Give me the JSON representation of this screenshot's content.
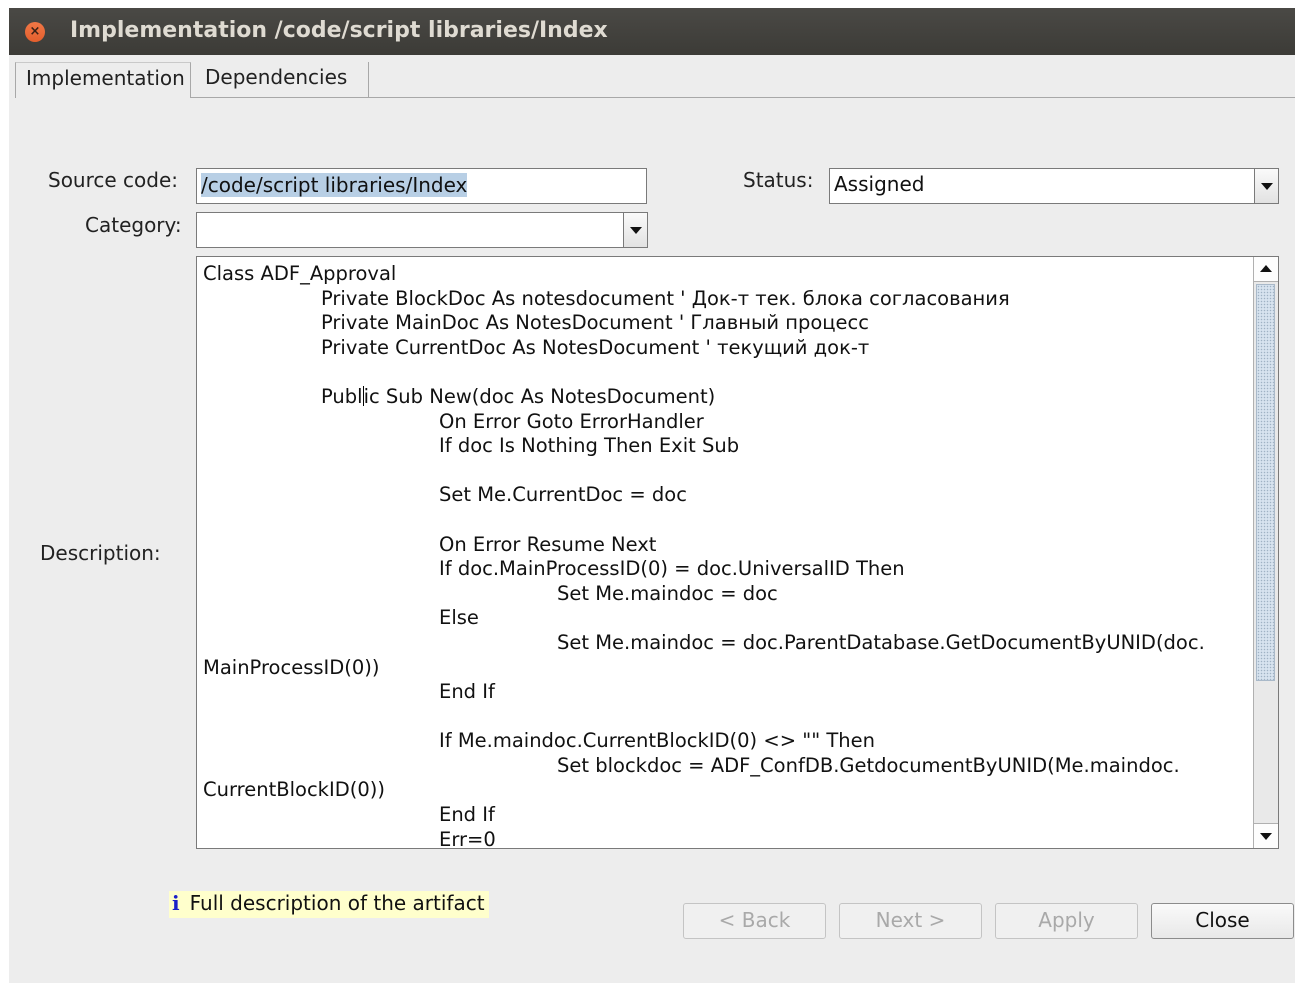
{
  "window": {
    "title": "Implementation /code/script libraries/Index"
  },
  "tabs": [
    {
      "label": "Implementation",
      "active": true
    },
    {
      "label": "Dependencies",
      "active": false
    }
  ],
  "form": {
    "source_code_label": "Source code:",
    "source_code_value": "/code/script libraries/Index",
    "status_label": "Status:",
    "status_value": "Assigned",
    "category_label": "Category:",
    "category_value": "",
    "description_label": "Description:",
    "description_lines": [
      {
        "indent": 0,
        "text": "Class ADF_Approval"
      },
      {
        "indent": 1,
        "text": "Private BlockDoc As notesdocument ' Док-т тек. блока согласования"
      },
      {
        "indent": 1,
        "text": "Private MainDoc As NotesDocument ' Главный процесс"
      },
      {
        "indent": 1,
        "text": "Private CurrentDoc As NotesDocument ' текущий док-т"
      },
      {
        "indent": 0,
        "text": ""
      },
      {
        "indent": 1,
        "text": "Public Sub New(doc As NotesDocument)"
      },
      {
        "indent": 2,
        "text": "On Error Goto ErrorHandler"
      },
      {
        "indent": 2,
        "text": "If doc Is Nothing Then Exit Sub"
      },
      {
        "indent": 0,
        "text": ""
      },
      {
        "indent": 2,
        "text": "Set Me.CurrentDoc = doc"
      },
      {
        "indent": 0,
        "text": ""
      },
      {
        "indent": 2,
        "text": "On Error Resume Next"
      },
      {
        "indent": 2,
        "text": "If doc.MainProcessID(0) = doc.UniversalID Then"
      },
      {
        "indent": 3,
        "text": "Set Me.maindoc = doc"
      },
      {
        "indent": 2,
        "text": "Else"
      },
      {
        "indent": 3,
        "text": "Set Me.maindoc = doc.ParentDatabase.GetDocumentByUNID(doc."
      },
      {
        "indent": 0,
        "text": "MainProcessID(0))"
      },
      {
        "indent": 2,
        "text": "End If"
      },
      {
        "indent": 0,
        "text": ""
      },
      {
        "indent": 2,
        "text": "If Me.maindoc.CurrentBlockID(0) <> \"\" Then"
      },
      {
        "indent": 3,
        "text": "Set blockdoc = ADF_ConfDB.GetdocumentByUNID(Me.maindoc."
      },
      {
        "indent": 0,
        "text": "CurrentBlockID(0))"
      },
      {
        "indent": 2,
        "text": "End If"
      },
      {
        "indent": 2,
        "text": "Err=0"
      }
    ]
  },
  "hint": {
    "icon": "info-icon",
    "text": "Full description of the artifact"
  },
  "buttons": {
    "back": {
      "label": "< Back",
      "enabled": false
    },
    "next": {
      "label": "Next >",
      "enabled": false
    },
    "apply": {
      "label": "Apply",
      "enabled": false
    },
    "close": {
      "label": "Close",
      "enabled": true
    }
  },
  "colors": {
    "titlebar": "#3c3b37",
    "close_button": "#e45f2d",
    "selection": "#b8cfe5",
    "hint_background": "#ffffcc",
    "info_icon": "#1b20c8"
  }
}
